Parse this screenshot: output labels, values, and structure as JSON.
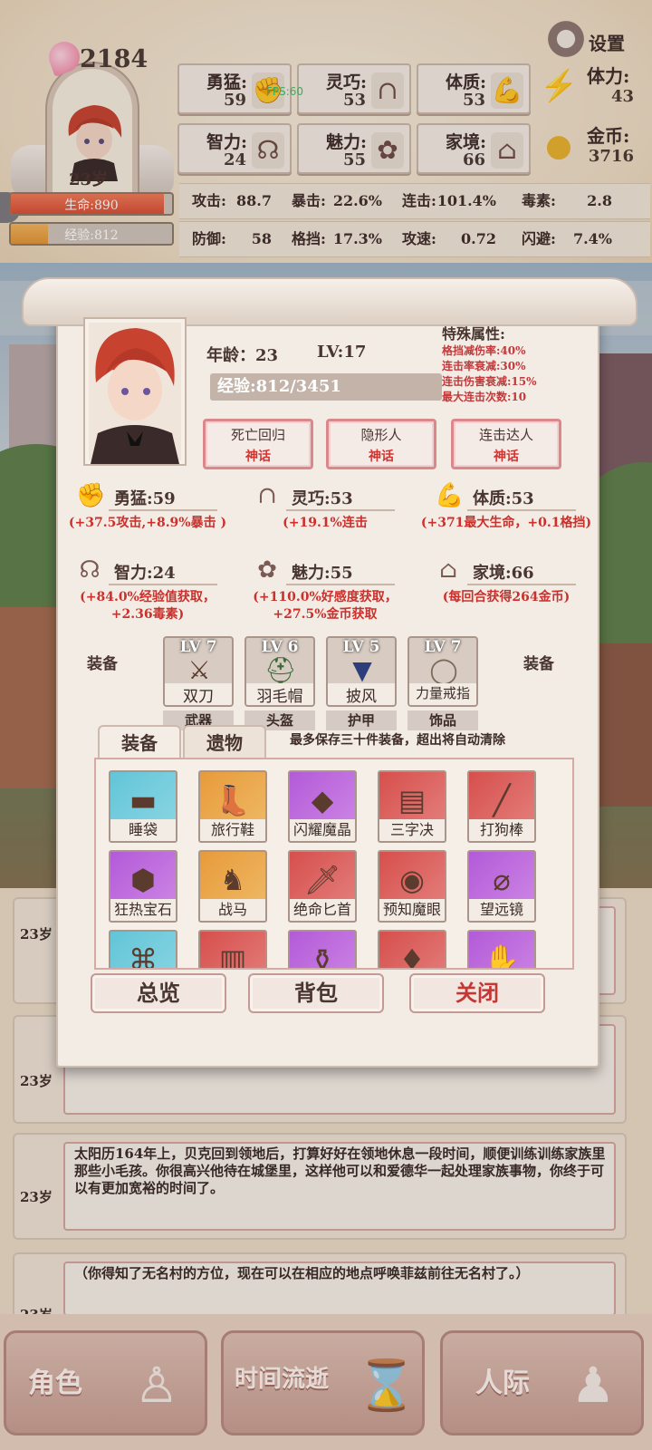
{
  "header": {
    "score": "2184",
    "age": "23岁",
    "hp": "生命:890",
    "exp": "经验:812",
    "hp_fraction": 0.95,
    "exp_fraction": 0.23,
    "settings_label": "设置",
    "fps": "FPS:60",
    "attributes": [
      {
        "label": "勇猛:",
        "value": "59",
        "icon": "fist-icon"
      },
      {
        "label": "灵巧:",
        "value": "53",
        "icon": "hair-icon"
      },
      {
        "label": "体质:",
        "value": "53",
        "icon": "arm-icon"
      },
      {
        "label": "智力:",
        "value": "24",
        "icon": "brain-icon"
      },
      {
        "label": "魅力:",
        "value": "55",
        "icon": "flower-icon"
      },
      {
        "label": "家境:",
        "value": "66",
        "icon": "home-icon"
      }
    ],
    "resources": {
      "stamina_label": "体力:",
      "stamina_value": "43",
      "gold_label": "金币:",
      "gold_value": "3716"
    },
    "combat_stats": [
      {
        "label": "攻击:",
        "value": "88.7"
      },
      {
        "label": "暴击:",
        "value": "22.6%"
      },
      {
        "label": "连击:",
        "value": "101.4%"
      },
      {
        "label": "毒素:",
        "value": "2.8"
      },
      {
        "label": "防御:",
        "value": "58"
      },
      {
        "label": "格挡:",
        "value": "17.3%"
      },
      {
        "label": "攻速:",
        "value": "0.72"
      },
      {
        "label": "闪避:",
        "value": "7.4%"
      }
    ]
  },
  "modal": {
    "age_label": "年龄：",
    "age_value": "23",
    "lv": "LV:17",
    "exp": "经验:812/3451",
    "special_title": "特殊属性:",
    "special_lines": [
      "格挡减伤率:40%",
      "连击率衰减:30%",
      "连击伤害衰减:15%",
      "最大连击次数:10"
    ],
    "talents": [
      {
        "name": "死亡回归",
        "rarity": "神话"
      },
      {
        "name": "隐形人",
        "rarity": "神话"
      },
      {
        "name": "连击达人",
        "rarity": "神话"
      }
    ],
    "attributes": [
      {
        "name": "勇猛:59",
        "desc": "(+37.5攻击,+8.9%暴击 )",
        "icon": "fist-icon"
      },
      {
        "name": "灵巧:53",
        "desc": "(+19.1%连击",
        "icon": "hair-icon"
      },
      {
        "name": "体质:53",
        "desc": "(+371最大生命，+0.1格挡)",
        "icon": "arm-icon"
      },
      {
        "name": "智力:24",
        "desc": "(+84.0%经验值获取，+2.36毒素)",
        "icon": "brain-icon"
      },
      {
        "name": "魅力:55",
        "desc": "(+110.0%好感度获取，+27.5%金币获取",
        "icon": "flower-icon"
      },
      {
        "name": "家境:66",
        "desc": "(每回合获得264金币)",
        "icon": "home-icon"
      }
    ],
    "equip_side_label": "装备",
    "equipment": [
      {
        "lv": "LV 7",
        "name": "双刀",
        "type": "武器",
        "icon": "dual-blades-icon"
      },
      {
        "lv": "LV 6",
        "name": "羽毛帽",
        "type": "头盔",
        "icon": "feather-hat-icon"
      },
      {
        "lv": "LV 5",
        "name": "披风",
        "type": "护甲",
        "icon": "cloak-icon"
      },
      {
        "lv": "LV 7",
        "name": "力量戒指",
        "type": "饰品",
        "icon": "ring-icon"
      }
    ],
    "tabs": [
      "装备",
      "遗物"
    ],
    "note": "最多保存三十件装备，超出将自动清除",
    "items": [
      {
        "name": "睡袋",
        "rarity": "blue",
        "icon": "sleeping-bag-icon"
      },
      {
        "name": "旅行鞋",
        "rarity": "orange",
        "icon": "boot-icon"
      },
      {
        "name": "闪耀魔晶",
        "rarity": "purple",
        "icon": "crystal-icon"
      },
      {
        "name": "三字决",
        "rarity": "red",
        "icon": "book-icon"
      },
      {
        "name": "打狗棒",
        "rarity": "red",
        "icon": "staff-icon"
      },
      {
        "name": "狂热宝石",
        "rarity": "purple",
        "icon": "gem-icon"
      },
      {
        "name": "战马",
        "rarity": "orange",
        "icon": "horse-icon"
      },
      {
        "name": "绝命匕首",
        "rarity": "red",
        "icon": "dagger-icon"
      },
      {
        "name": "预知魔眼",
        "rarity": "red",
        "icon": "eye-icon"
      },
      {
        "name": "望远镜",
        "rarity": "purple",
        "icon": "telescope-icon"
      },
      {
        "name": "",
        "rarity": "blue",
        "icon": "amulet-icon"
      },
      {
        "name": "",
        "rarity": "red",
        "icon": "armor-icon"
      },
      {
        "name": "",
        "rarity": "purple",
        "icon": "potion-icon"
      },
      {
        "name": "",
        "rarity": "red",
        "icon": "lantern-icon"
      },
      {
        "name": "",
        "rarity": "purple",
        "icon": "glove-icon"
      }
    ],
    "buttons": {
      "overview": "总览",
      "backpack": "背包",
      "close": "关闭"
    }
  },
  "log": [
    {
      "age": "23岁",
      "text": ""
    },
    {
      "age": "23岁",
      "text": ""
    },
    {
      "age": "23岁",
      "text": "太阳历164年上，贝克回到领地后，打算好好在领地休息一段时间，顺便训练训练家族里那些小毛孩。你很高兴他待在城堡里，这样他可以和爱德华一起处理家族事物，你终于可以有更加宽裕的时间了。"
    },
    {
      "age": "23岁",
      "text": "（你得知了无名村的方位，现在可以在相应的地点呼唤菲兹前往无名村了。）"
    }
  ],
  "nav": {
    "character": "角色",
    "time": "时间流逝",
    "social": "人际"
  }
}
